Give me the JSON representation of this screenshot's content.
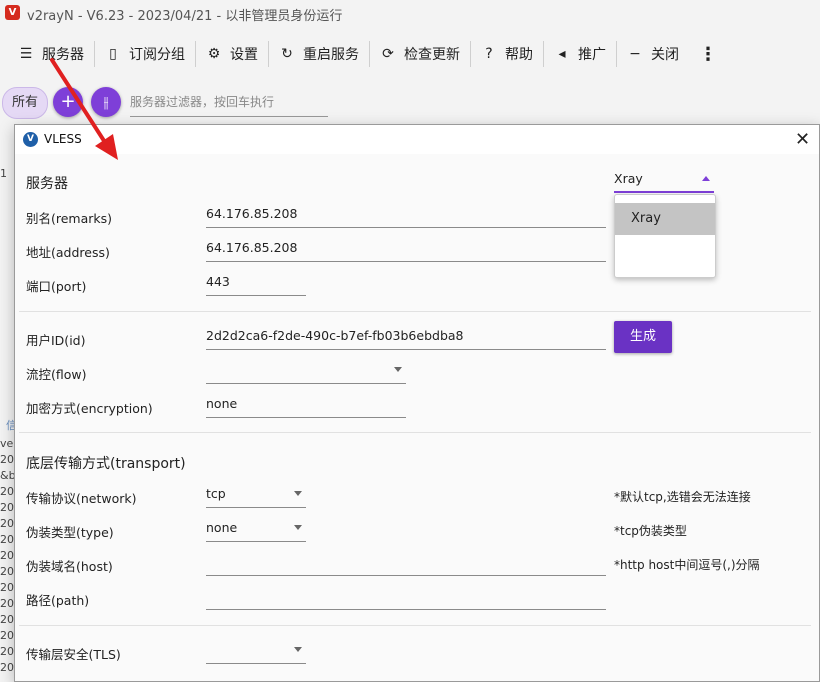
{
  "app": {
    "title": "v2rayN - V6.23 - 2023/04/21 - 以非管理员身份运行",
    "logo": "V"
  },
  "toolbar": [
    {
      "label": "服务器",
      "icon": "server-icon",
      "glyph": "☰"
    },
    {
      "label": "订阅分组",
      "icon": "bookmark-icon",
      "glyph": "▯"
    },
    {
      "label": "设置",
      "icon": "gear-icon",
      "glyph": "⚙"
    },
    {
      "label": "重启服务",
      "icon": "restart-icon",
      "glyph": "↻"
    },
    {
      "label": "检查更新",
      "icon": "update-icon",
      "glyph": "⟳"
    },
    {
      "label": "帮助",
      "icon": "help-icon",
      "glyph": "?"
    },
    {
      "label": "推广",
      "icon": "megaphone-icon",
      "glyph": "◂"
    },
    {
      "label": "关闭",
      "icon": "minus-icon",
      "glyph": "−"
    }
  ],
  "more_glyph": "⋮",
  "filter": {
    "chip": "所有",
    "add_glyph": "+",
    "split_glyph": "⫲",
    "placeholder": "服务器过滤器，按回车执行"
  },
  "background_fragments": {
    "row1": "1",
    "row_a": "信",
    "row_b": "ve",
    "row_c": "&b",
    "row_d": "20"
  },
  "dialog": {
    "title": "VLESS",
    "logo": "V",
    "close_glyph": "✕",
    "server_section": "服务器",
    "core_select": "Xray",
    "core_options": [
      "Xray"
    ],
    "fields": {
      "remarks_label": "别名(remarks)",
      "remarks_value": "64.176.85.208",
      "address_label": "地址(address)",
      "address_value": "64.176.85.208",
      "port_label": "端口(port)",
      "port_value": "443",
      "id_label": "用户ID(id)",
      "id_value": "2d2d2ca6-f2de-490c-b7ef-fb03b6ebdba8",
      "generate_button": "生成",
      "flow_label": "流控(flow)",
      "flow_value": "",
      "encryption_label": "加密方式(encryption)",
      "encryption_value": "none"
    },
    "transport": {
      "section": "底层传输方式(transport)",
      "network_label": "传输协议(network)",
      "network_value": "tcp",
      "network_hint": "*默认tcp,选错会无法连接",
      "type_label": "伪装类型(type)",
      "type_value": "none",
      "type_hint": "*tcp伪装类型",
      "host_label": "伪装域名(host)",
      "host_value": "",
      "host_hint": "*http host中间逗号(,)分隔",
      "path_label": "路径(path)",
      "path_value": ""
    },
    "tls": {
      "label": "传输层安全(TLS)",
      "value": ""
    }
  },
  "colors": {
    "accent": "#7e3fd8",
    "button": "#6a32c4",
    "arrow": "#e02020"
  }
}
